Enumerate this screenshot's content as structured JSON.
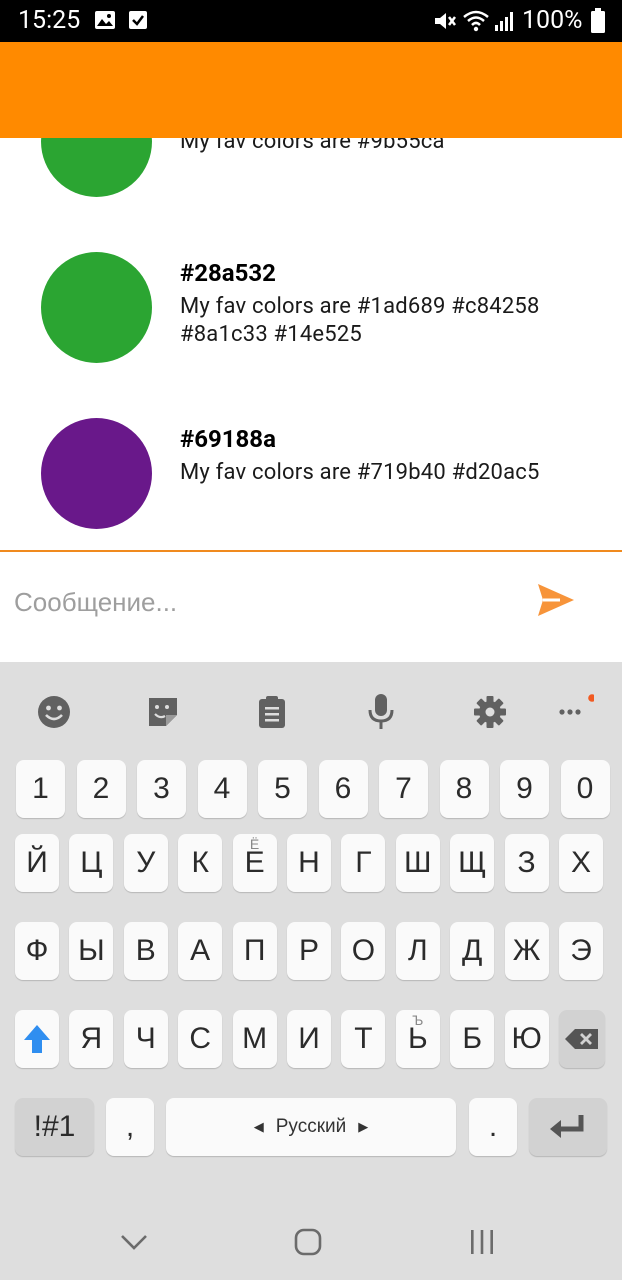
{
  "status_bar": {
    "time": "15:25",
    "battery": "100%",
    "icons": [
      "gallery-icon",
      "check-icon",
      "mute-icon",
      "wifi-icon",
      "signal-icon",
      "battery-icon"
    ]
  },
  "toolbar": {
    "color": "#ff8a00"
  },
  "messages": [
    {
      "title": "",
      "text": "My fav colors are #9b55ca",
      "avatar_color": "#2ba532"
    },
    {
      "title": "#28a532",
      "text": "My fav colors are #1ad689 #c84258 #8a1c33 #14e525",
      "avatar_color": "#2ba532"
    },
    {
      "title": "#69188a",
      "text": "My fav colors are #719b40 #d20ac5",
      "avatar_color": "#69188a"
    }
  ],
  "composer": {
    "placeholder": "Сообщение...",
    "accent": "#f7943a"
  },
  "keyboard": {
    "tools": [
      "emoji-icon",
      "sticker-icon",
      "clipboard-icon",
      "microphone-icon",
      "settings-icon",
      "more-icon"
    ],
    "number_row": [
      "1",
      "2",
      "3",
      "4",
      "5",
      "6",
      "7",
      "8",
      "9",
      "0"
    ],
    "row1": [
      "Й",
      "Ц",
      "У",
      "К",
      "Е",
      "Н",
      "Г",
      "Ш",
      "Щ",
      "З",
      "Х"
    ],
    "row1_hint": "Ё",
    "row2": [
      "Ф",
      "Ы",
      "В",
      "А",
      "П",
      "Р",
      "О",
      "Л",
      "Д",
      "Ж",
      "Э"
    ],
    "row3": [
      "Я",
      "Ч",
      "С",
      "М",
      "И",
      "Т",
      "Ь",
      "Б",
      "Ю"
    ],
    "row3_hint": "Ъ",
    "symbols_label": "!#1",
    "comma": ",",
    "space_label": "Русский",
    "period": "."
  },
  "nav": [
    "back-icon",
    "home-icon",
    "recents-icon"
  ]
}
